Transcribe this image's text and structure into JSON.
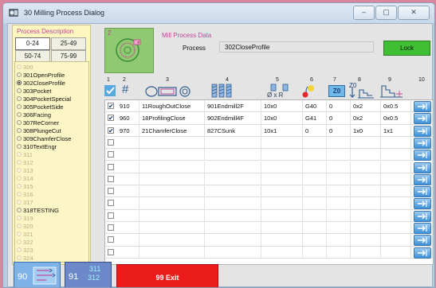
{
  "window": {
    "title": "30 Milling Process Dialog",
    "buttons": [
      "–",
      "▢",
      "✕"
    ]
  },
  "description": {
    "title": "Process Description",
    "ranges": [
      "0-24",
      "25-49",
      "50-74",
      "75-99"
    ],
    "selected_range": "0-24",
    "items": [
      {
        "label": "300",
        "used": false,
        "selected": false
      },
      {
        "label": "301OpenProfile",
        "used": true,
        "selected": false
      },
      {
        "label": "302CloseProfile",
        "used": true,
        "selected": true
      },
      {
        "label": "303Pocket",
        "used": true,
        "selected": false
      },
      {
        "label": "304PocketSpecial",
        "used": true,
        "selected": false
      },
      {
        "label": "305PocketSide",
        "used": true,
        "selected": false
      },
      {
        "label": "306Facing",
        "used": true,
        "selected": false
      },
      {
        "label": "307ReCorner",
        "used": true,
        "selected": false
      },
      {
        "label": "308PlungeCut",
        "used": true,
        "selected": false
      },
      {
        "label": "309ChamferClose",
        "used": true,
        "selected": false
      },
      {
        "label": "310TextEngr",
        "used": true,
        "selected": false
      },
      {
        "label": "311",
        "used": false,
        "selected": false
      },
      {
        "label": "312",
        "used": false,
        "selected": false
      },
      {
        "label": "313",
        "used": false,
        "selected": false
      },
      {
        "label": "314",
        "used": false,
        "selected": false
      },
      {
        "label": "315",
        "used": false,
        "selected": false
      },
      {
        "label": "316",
        "used": false,
        "selected": false
      },
      {
        "label": "317",
        "used": false,
        "selected": false
      },
      {
        "label": "318TESTING",
        "used": true,
        "selected": false
      },
      {
        "label": "319",
        "used": false,
        "selected": false
      },
      {
        "label": "320",
        "used": false,
        "selected": false
      },
      {
        "label": "321",
        "used": false,
        "selected": false
      },
      {
        "label": "322",
        "used": false,
        "selected": false
      },
      {
        "label": "323",
        "used": false,
        "selected": false
      },
      {
        "label": "324",
        "used": false,
        "selected": false
      }
    ]
  },
  "thumbnail": {
    "number": "2"
  },
  "process_data": {
    "title": "Mill Process Data",
    "process_label": "Process",
    "process_value": "302CloseProfile",
    "lock_label": "Lock",
    "lock_color": "#3fbf33"
  },
  "table": {
    "column_numbers": [
      "1",
      "2",
      "3",
      "4",
      "5",
      "6",
      "7",
      "8",
      "9",
      "10"
    ],
    "header_icons": [
      "checkmark-icon",
      "hash-icon",
      "toolpath-shapes-icon",
      "endmill-tools-icon",
      "tool-diameter-radius-icon",
      "spindle-direction-icon",
      "z0-icon",
      "z0-depth-icon",
      "step-profile-icon",
      "run-arrow-icon"
    ],
    "header_texts": {
      "hash": "#",
      "diameter": "Ø x R",
      "z0": "Z0",
      "z0b": "Z0"
    },
    "rows": [
      {
        "checked": true,
        "num": "910",
        "name": "11RoughOutClose",
        "tool": "901Endmill2F",
        "dim": "10x0",
        "g": "G40",
        "z0": "0",
        "stepz": "0x2",
        "stepxy": "0x0.5"
      },
      {
        "checked": true,
        "num": "960",
        "name": "18ProfilingClose",
        "tool": "902Endmill4F",
        "dim": "10x0",
        "g": "G41",
        "z0": "0",
        "stepz": "0x2",
        "stepxy": "0x0.5"
      },
      {
        "checked": true,
        "num": "970",
        "name": "21ChamferClose",
        "tool": "827CSunk",
        "dim": "10x1",
        "g": "0",
        "z0": "0",
        "stepz": "1x0",
        "stepxy": "1x1"
      },
      {
        "checked": false
      },
      {
        "checked": false
      },
      {
        "checked": false
      },
      {
        "checked": false
      },
      {
        "checked": false
      },
      {
        "checked": false
      },
      {
        "checked": false
      },
      {
        "checked": false
      },
      {
        "checked": false
      },
      {
        "checked": false
      }
    ]
  },
  "footer": {
    "btn_a": {
      "main": "90",
      "icon": "sequence-arrows-icon"
    },
    "btn_b": {
      "main": "91",
      "sub1": "311",
      "sub2": "312"
    },
    "exit_label": "99 Exit",
    "exit_color": "#ec1c1c"
  }
}
